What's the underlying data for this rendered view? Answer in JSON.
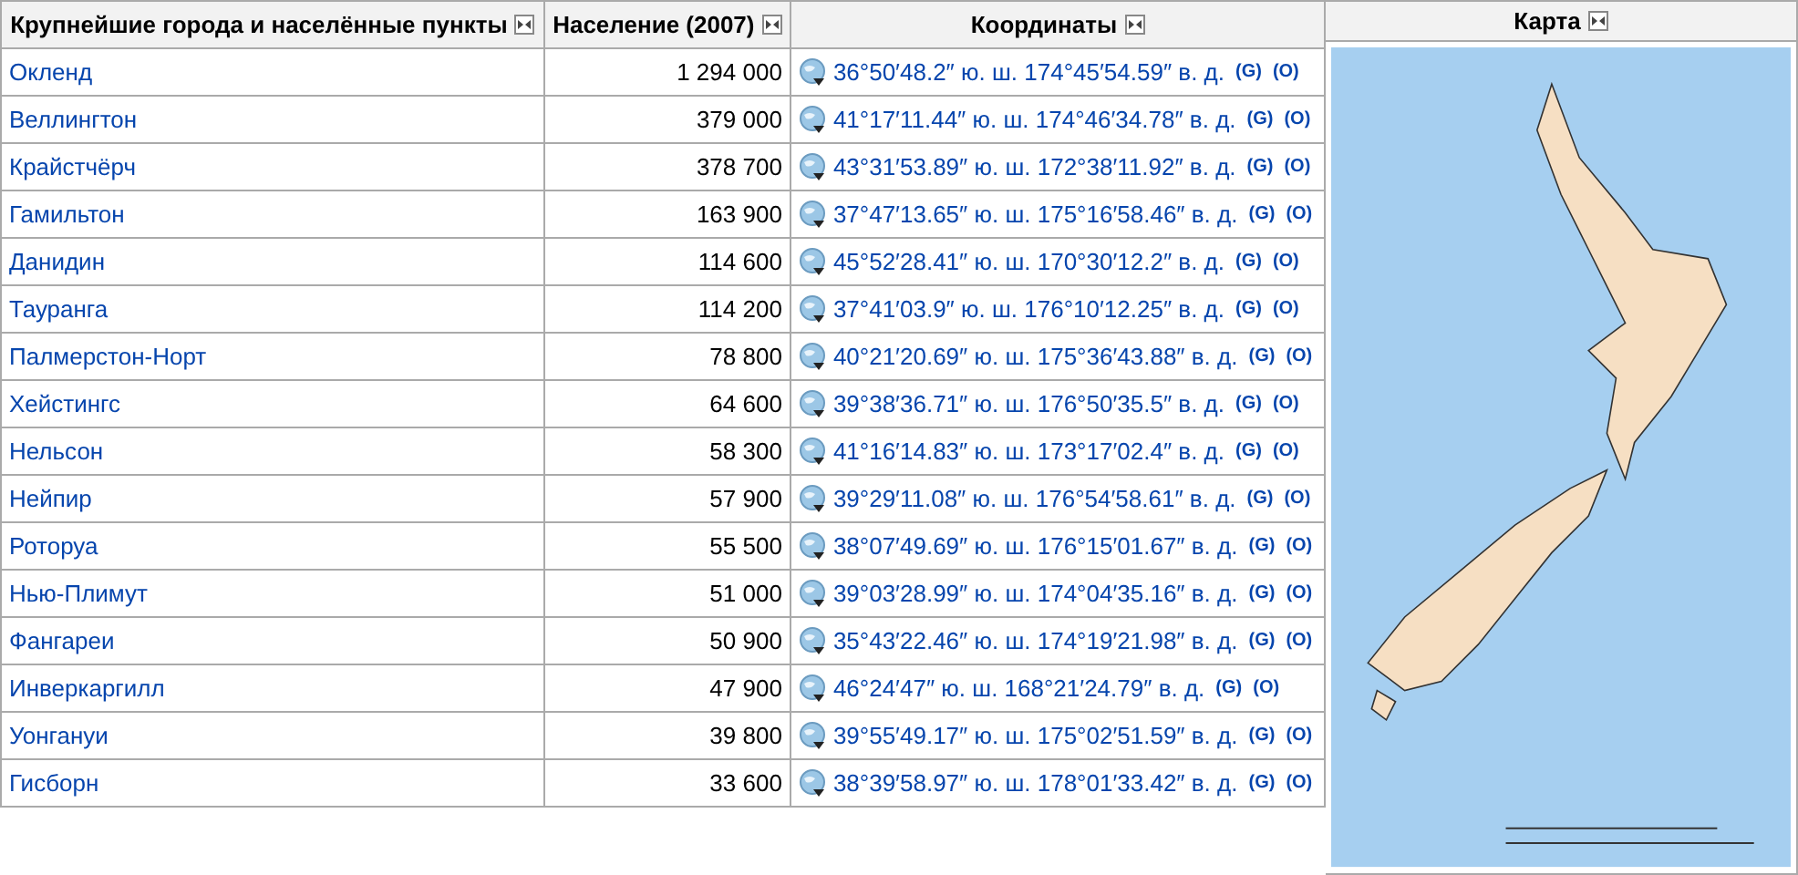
{
  "table": {
    "columns": [
      {
        "label": "Крупнейшие города и населённые пункты",
        "sort_icon": true
      },
      {
        "label": "Население (2007)",
        "sort_icon": true
      },
      {
        "label": "Координаты",
        "sort_icon": true
      }
    ],
    "rows": [
      {
        "city": "Окленд",
        "population": "1 294 000",
        "coordinates": "36°50′48.2″ ю. ш. 174°45′54.59″ в. д.",
        "links": [
          "(G)",
          "(O)"
        ]
      },
      {
        "city": "Веллингтон",
        "population": "379 000",
        "coordinates": "41°17′11.44″ ю. ш. 174°46′34.78″ в. д.",
        "links": [
          "(G)",
          "(O)"
        ]
      },
      {
        "city": "Крайстчёрч",
        "population": "378 700",
        "coordinates": "43°31′53.89″ ю. ш. 172°38′11.92″ в. д.",
        "links": [
          "(G)",
          "(O)"
        ]
      },
      {
        "city": "Гамильтон",
        "population": "163 900",
        "coordinates": "37°47′13.65″ ю. ш. 175°16′58.46″ в. д.",
        "links": [
          "(G)",
          "(O)"
        ]
      },
      {
        "city": "Данидин",
        "population": "114 600",
        "coordinates": "45°52′28.41″ ю. ш. 170°30′12.2″ в. д.",
        "links": [
          "(G)",
          "(O)"
        ]
      },
      {
        "city": "Тауранга",
        "population": "114 200",
        "coordinates": "37°41′03.9″ ю. ш. 176°10′12.25″ в. д.",
        "links": [
          "(G)",
          "(O)"
        ]
      },
      {
        "city": "Палмерстон-Норт",
        "population": "78 800",
        "coordinates": "40°21′20.69″ ю. ш. 175°36′43.88″ в. д.",
        "links": [
          "(G)",
          "(O)"
        ]
      },
      {
        "city": "Хейстингс",
        "population": "64 600",
        "coordinates": "39°38′36.71″ ю. ш. 176°50′35.5″ в. д.",
        "links": [
          "(G)",
          "(O)"
        ]
      },
      {
        "city": "Нельсон",
        "population": "58 300",
        "coordinates": "41°16′14.83″ ю. ш. 173°17′02.4″ в. д.",
        "links": [
          "(G)",
          "(O)"
        ]
      },
      {
        "city": "Нейпир",
        "population": "57 900",
        "coordinates": "39°29′11.08″ ю. ш. 176°54′58.61″ в. д.",
        "links": [
          "(G)",
          "(O)"
        ]
      },
      {
        "city": "Роторуа",
        "population": "55 500",
        "coordinates": "38°07′49.69″ ю. ш. 176°15′01.67″ в. д.",
        "links": [
          "(G)",
          "(O)"
        ]
      },
      {
        "city": "Нью-Плимут",
        "population": "51 000",
        "coordinates": "39°03′28.99″ ю. ш. 174°04′35.16″ в. д.",
        "links": [
          "(G)",
          "(O)"
        ]
      },
      {
        "city": "Фангареи",
        "population": "50 900",
        "coordinates": "35°43′22.46″ ю. ш. 174°19′21.98″ в. д.",
        "links": [
          "(G)",
          "(O)"
        ]
      },
      {
        "city": "Инверкаргилл",
        "population": "47 900",
        "coordinates": "46°24′47″ ю. ш. 168°21′24.79″ в. д.",
        "links": [
          "(G)",
          "(O)"
        ]
      },
      {
        "city": "Уонгануи",
        "population": "39 800",
        "coordinates": "39°55′49.17″ ю. ш. 175°02′51.59″ в. д.",
        "links": [
          "(G)",
          "(O)"
        ]
      },
      {
        "city": "Гисборн",
        "population": "33 600",
        "coordinates": "38°39′58.97″ ю. ш. 178°01′33.42″ в. д.",
        "links": [
          "(G)",
          "(O)"
        ]
      }
    ]
  },
  "map": {
    "label": "Карта",
    "sort_icon": true
  }
}
